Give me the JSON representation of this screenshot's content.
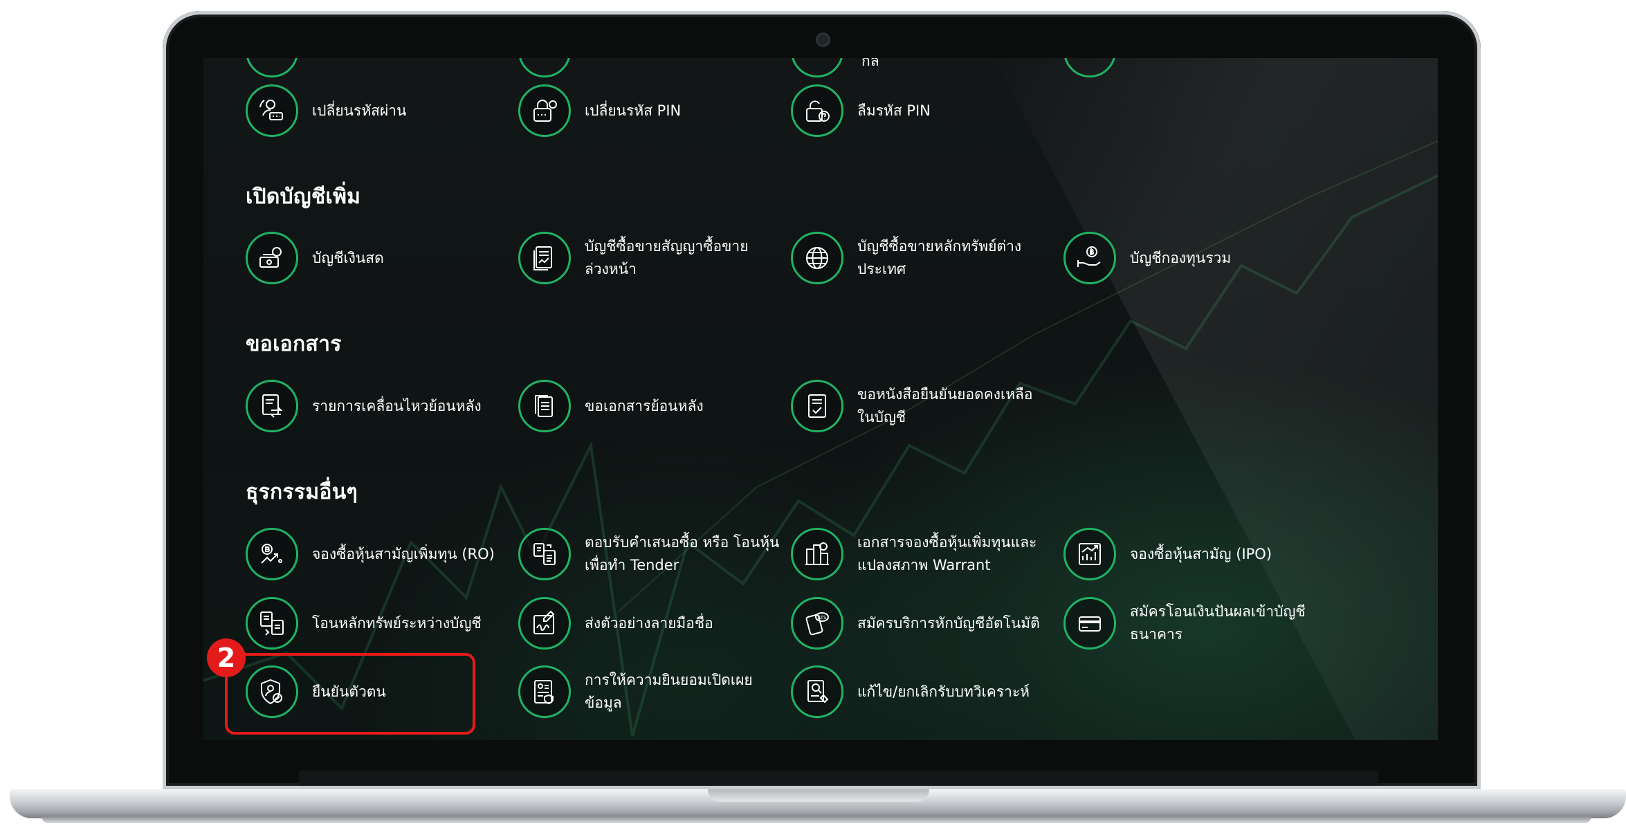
{
  "sections": [
    {
      "title": "",
      "items": [
        {
          "label": "เปลี่ยนรหัสผ่าน",
          "icon": "password-change-icon"
        },
        {
          "label": "เปลี่ยนรหัส PIN",
          "icon": "pin-change-icon"
        },
        {
          "label": "ลืมรหัส PIN",
          "icon": "forgot-pin-icon"
        }
      ]
    },
    {
      "title": "เปิดบัญชีเพิ่ม",
      "items": [
        {
          "label": "บัญชีเงินสด",
          "icon": "cash-account-icon"
        },
        {
          "label": "บัญชีซื้อขายสัญญาซื้อขาย\nล่วงหน้า",
          "icon": "derivatives-account-icon"
        },
        {
          "label": "บัญชีซื้อขายหลักทรัพย์ต่าง\nประเทศ",
          "icon": "globe-icon"
        },
        {
          "label": "บัญชีกองทุนรวม",
          "icon": "mutual-fund-icon"
        }
      ]
    },
    {
      "title": "ขอเอกสาร",
      "items": [
        {
          "label": "รายการเคลื่อนไหวย้อนหลัง",
          "icon": "transaction-history-icon"
        },
        {
          "label": "ขอเอกสารย้อนหลัง",
          "icon": "document-history-icon"
        },
        {
          "label": "ขอหนังสือยืนยันยอดคงเหลือ\nในบัญชี",
          "icon": "balance-confirmation-icon"
        }
      ]
    },
    {
      "title": "ธุรกรรมอื่นๆ",
      "items": [
        {
          "label": "จองซื้อหุ้นสามัญเพิ่มทุน (RO)",
          "icon": "rights-offering-icon"
        },
        {
          "label": "ตอบรับคำเสนอซื้อ หรือ โอนหุ้น\nเพื่อทำ Tender",
          "icon": "tender-offer-icon"
        },
        {
          "label": "เอกสารจองซื้อหุ้นเพิ่มทุนและ\nแปลงสภาพ Warrant",
          "icon": "warrant-document-icon"
        },
        {
          "label": "จองซื้อหุ้นสามัญ (IPO)",
          "icon": "ipo-icon"
        },
        {
          "label": "โอนหลักทรัพย์ระหว่างบัญชี",
          "icon": "securities-transfer-icon"
        },
        {
          "label": "ส่งตัวอย่างลายมือชื่อ",
          "icon": "signature-icon"
        },
        {
          "label": "สมัครบริการหักบัญชีอัตโนมัติ",
          "icon": "ats-icon"
        },
        {
          "label": "สมัครโอนเงินปันผลเข้าบัญชี\nธนาคาร",
          "icon": "card-icon"
        },
        {
          "label": "ยืนยันตัวตน",
          "icon": "identity-verify-icon"
        },
        {
          "label": "การให้ความยินยอมเปิดเผย\nข้อมูล",
          "icon": "data-consent-icon"
        },
        {
          "label": "แก้ไข/ยกเลิกรับบทวิเคราะห์",
          "icon": "research-subscription-icon"
        }
      ]
    }
  ],
  "partial_top_row": {
    "label": "กล"
  },
  "annotation": {
    "step_number": "2",
    "color": "#e31b1b"
  },
  "colors": {
    "accent": "#1fb364",
    "background": "#111616",
    "text": "#ffffff"
  }
}
